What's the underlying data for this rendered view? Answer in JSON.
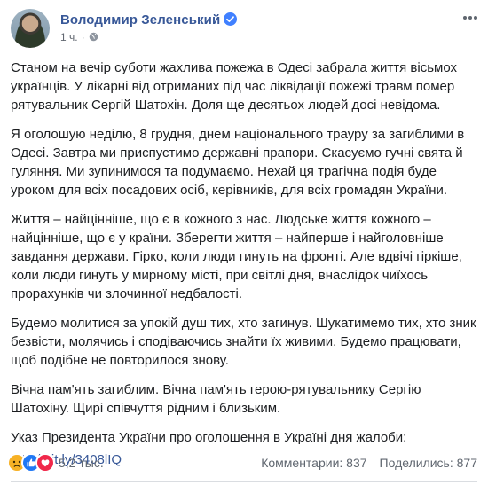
{
  "post": {
    "author": "Володимир Зеленський",
    "time": "1 ч.",
    "separator": "·",
    "paragraphs": [
      "Станом на вечір суботи жахлива пожежа в Одесі забрала життя вісьмох українців. У лікарні від отриманих під час ліквідації пожежі травм помер рятувальник Сергій Шатохін. Доля ще десятьох людей досі невідома.",
      "Я оголошую неділю, 8 грудня, днем національного трауру за загиблими в Одесі. Завтра ми приспустимо державні прапори. Скасуємо гучні свята й гуляння. Ми зупинимося та подумаємо. Нехай ця трагічна подія буде уроком для всіх посадових осіб, керівників, для всіх громадян України.",
      "Життя – найцінніше, що є в кожного з нас. Людське життя кожного – найцінніше, що є у країни. Зберегти життя – найперше і найголовніше завдання держави. Гірко, коли люди гинуть на фронті. Але вдвічі гіркіше, коли люди гинуть у мирному місті, при світлі дня, внаслідок чиїхось прорахунків чи злочинної недбалості.",
      "Будемо молитися за упокій душ тих, хто загинув. Шукатимемо тих, хто зник безвісти, молячись і сподіваючись знайти їх живими. Будемо працювати, щоб подібне не повторилося знову.",
      "Вічна пам'ять загиблим. Вічна пам'ять герою-рятувальнику Сергію Шатохіну. Щирі співчуття рідним і близьким.",
      "Указ Президента України про оголошення в Україні дня жалоби:"
    ],
    "link": "http://bit.ly/3408lIQ"
  },
  "footer": {
    "reaction_count": "5,2 тыс.",
    "comments": "Комментарии: 837",
    "shares": "Поделились: 877"
  },
  "icons": {
    "verified": "verified-badge-icon",
    "privacy": "globe-icon",
    "menu": "more-options-icon",
    "reactions": [
      "sad-reaction-icon",
      "like-reaction-icon",
      "love-reaction-icon"
    ]
  },
  "colors": {
    "author": "#385898",
    "verified": "#4080ff",
    "meta": "#616770",
    "text": "#1c1e21",
    "like": "#2078f4",
    "love": "#f0284a",
    "sad": "#f7b125"
  }
}
